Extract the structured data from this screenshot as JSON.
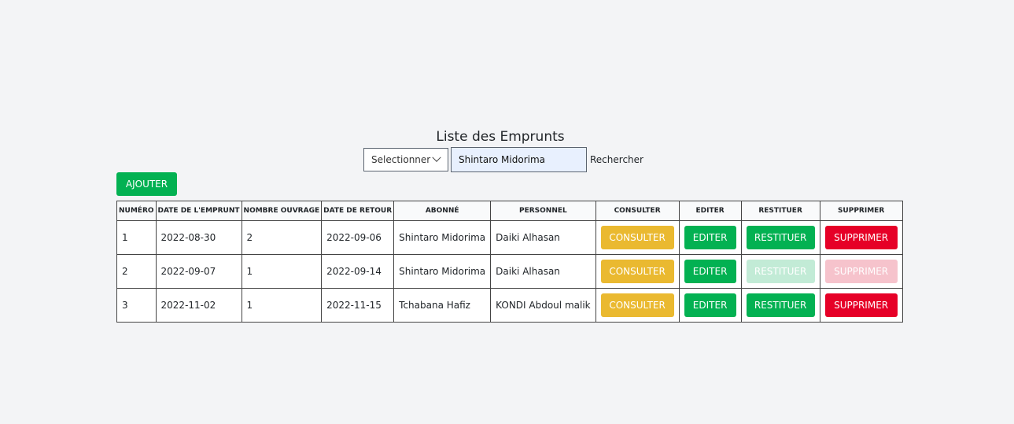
{
  "page": {
    "title": "Liste des Emprunts"
  },
  "search": {
    "select_value": "Selectionner",
    "input_value": "Shintaro Midorima",
    "label": "Rechercher"
  },
  "actions": {
    "add_label": "AJOUTER"
  },
  "table": {
    "headers": [
      "NUMÉRO",
      "DATE DE L'EMPRUNT",
      "NOMBRE OUVRAGE",
      "DATE DE RETOUR",
      "ABONNÉ",
      "PERSONNEL",
      "CONSULTER",
      "EDITER",
      "RESTITUER",
      "SUPPRIMER"
    ],
    "rows": [
      {
        "numero": "1",
        "date_emprunt": "2022-08-30",
        "nombre": "2",
        "date_retour": "2022-09-06",
        "abonne": "Shintaro Midorima",
        "personnel": "Daiki Alhasan",
        "consulter": "CONSULTER",
        "editer": "EDITER",
        "restituer": "RESTITUER",
        "supprimer": "SUPPRIMER"
      },
      {
        "numero": "2",
        "date_emprunt": "2022-09-07",
        "nombre": "1",
        "date_retour": "2022-09-14",
        "abonne": "Shintaro Midorima",
        "personnel": "Daiki Alhasan",
        "consulter": "CONSULTER",
        "editer": "EDITER",
        "restituer": "RESTITUER",
        "supprimer": "SUPPRIMER"
      },
      {
        "numero": "3",
        "date_emprunt": "2022-11-02",
        "nombre": "1",
        "date_retour": "2022-11-15",
        "abonne": "Tchabana Hafiz",
        "personnel": "KONDI Abdoul malik",
        "consulter": "CONSULTER",
        "editer": "EDITER",
        "restituer": "RESTITUER",
        "supprimer": "SUPPRIMER"
      }
    ]
  },
  "colors": {
    "background": "#f3f4f6",
    "success": "#03b152",
    "warning": "#eab930",
    "danger": "#e60027"
  },
  "icons": {
    "select_arrow": "chevron-down-icon"
  }
}
